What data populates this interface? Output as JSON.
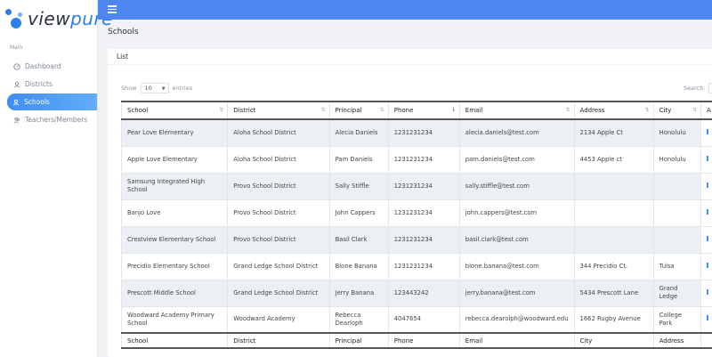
{
  "brand": {
    "view": "view",
    "pure": "pure"
  },
  "sidebar": {
    "section": "Main",
    "items": [
      {
        "label": "Dashboard"
      },
      {
        "label": "Districts"
      },
      {
        "label": "Schools"
      },
      {
        "label": "Teachers/Members"
      }
    ]
  },
  "page": {
    "title": "Schools"
  },
  "card": {
    "title": "List"
  },
  "controls": {
    "show_label": "Show",
    "show_value": "10",
    "entries_label": "entries",
    "search_label": "Search:"
  },
  "table": {
    "headers": [
      "School",
      "District",
      "Principal",
      "Phone",
      "Email",
      "Address",
      "City",
      "A"
    ],
    "footers": [
      "School",
      "District",
      "Principal",
      "Phone",
      "Email",
      "City",
      "Address",
      ""
    ],
    "rows": [
      [
        "Pear Love Elementary",
        "Aloha School District",
        "Alecia Daniels",
        "1231231234",
        "alecia.daniels@test.com",
        "2134 Apple Ct",
        "Honolulu"
      ],
      [
        "Apple Love Elementary",
        "Aloha School District",
        "Pam Daniels",
        "1231231234",
        "pam.daniels@test.com",
        "4453 Apple ct",
        "Honolulu"
      ],
      [
        "Samsung Integrated High School",
        "Provo School District",
        "Sally Stiffle",
        "1231231234",
        "sally.stiffle@test.com",
        "",
        ""
      ],
      [
        "Banjo Love",
        "Provo School District",
        "John Cappers",
        "1231231234",
        "john.cappers@test.com",
        "",
        ""
      ],
      [
        "Crestview Elementary School",
        "Provo School District",
        "Basil Clark",
        "1231231234",
        "basil.clark@test.com",
        "",
        ""
      ],
      [
        "Precidio Elementary School",
        "Grand Ledge School District",
        "Blone Banana",
        "1231231234",
        "blone.banana@test.com",
        "344 Precidio Ct.",
        "Tulsa"
      ],
      [
        "Prescott Middle School",
        "Grand Ledge School District",
        "Jerry Banana",
        "123443242",
        "jerry.banana@test.com",
        "5434 Prescott Lane",
        "Grand Ledge"
      ],
      [
        "Woodward Academy Primary School",
        "Woodward Academy",
        "Rebecca Dearloph",
        "4047654",
        "rebecca.dearolph@woodward.edu",
        "1662 Rugby Avenue",
        "College Park"
      ]
    ]
  },
  "colors": {
    "accent": "#4f87f2",
    "active_nav": "#3f8ef5"
  }
}
